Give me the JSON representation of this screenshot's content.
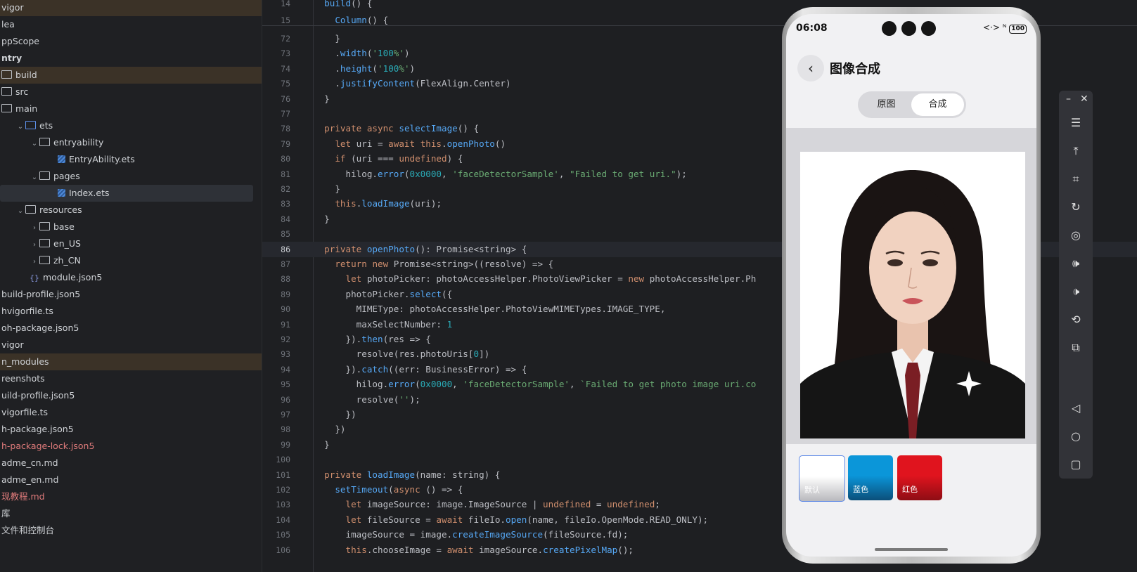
{
  "tree": {
    "rows": [
      {
        "label": "vigor",
        "indent": 0,
        "hl": "brown"
      },
      {
        "label": "lea",
        "indent": 0
      },
      {
        "label": "ppScope",
        "indent": 0
      },
      {
        "label": "ntry",
        "indent": 0,
        "bold": true
      },
      {
        "label": "build",
        "indent": 0,
        "hl": "brown",
        "prefix": "folder"
      },
      {
        "label": "src",
        "indent": 0,
        "prefix": "folder"
      },
      {
        "label": "main",
        "indent": 0,
        "prefix": "folder"
      },
      {
        "label": "ets",
        "indent": 1,
        "chev": "v",
        "prefix": "folder-blue"
      },
      {
        "label": "entryability",
        "indent": 2,
        "chev": "v",
        "prefix": "folder"
      },
      {
        "label": "EntryAbility.ets",
        "indent": 4,
        "prefix": "file"
      },
      {
        "label": "pages",
        "indent": 2,
        "chev": "v",
        "prefix": "folder"
      },
      {
        "label": "Index.ets",
        "indent": 4,
        "prefix": "file",
        "hl": "sel"
      },
      {
        "label": "resources",
        "indent": 1,
        "chev": "v",
        "prefix": "folder"
      },
      {
        "label": "base",
        "indent": 2,
        "chev": ">",
        "prefix": "folder"
      },
      {
        "label": "en_US",
        "indent": 2,
        "chev": ">",
        "prefix": "folder"
      },
      {
        "label": "zh_CN",
        "indent": 2,
        "chev": ">",
        "prefix": "folder"
      },
      {
        "label": "module.json5",
        "indent": 2,
        "prefix": "json"
      },
      {
        "label": "build-profile.json5",
        "indent": 0
      },
      {
        "label": "hvigorfile.ts",
        "indent": 0
      },
      {
        "label": "oh-package.json5",
        "indent": 0
      },
      {
        "label": "vigor",
        "indent": 0
      },
      {
        "label": "n_modules",
        "indent": 0,
        "hl": "brown"
      },
      {
        "label": "reenshots",
        "indent": 0
      },
      {
        "label": "uild-profile.json5",
        "indent": 0
      },
      {
        "label": "vigorfile.ts",
        "indent": 0
      },
      {
        "label": "h-package.json5",
        "indent": 0
      },
      {
        "label": "h-package-lock.json5",
        "indent": 0,
        "red": true
      },
      {
        "label": "adme_cn.md",
        "indent": 0
      },
      {
        "label": "adme_en.md",
        "indent": 0
      },
      {
        "label": "现教程.md",
        "indent": 0,
        "red": true
      },
      {
        "label": "库",
        "indent": 0
      },
      {
        "label": "文件和控制台",
        "indent": 0
      }
    ]
  },
  "editor": {
    "current_line": "86",
    "lines": [
      {
        "n": "14",
        "t": "  build() {"
      },
      {
        "n": "15",
        "t": "    Column() {"
      },
      {
        "n": "72",
        "t": "    }"
      },
      {
        "n": "73",
        "t": "    .width('100%')"
      },
      {
        "n": "74",
        "t": "    .height('100%')"
      },
      {
        "n": "75",
        "t": "    .justifyContent(FlexAlign.Center)"
      },
      {
        "n": "76",
        "t": "  }"
      },
      {
        "n": "77",
        "t": ""
      },
      {
        "n": "78",
        "t": "  private async selectImage() {"
      },
      {
        "n": "79",
        "t": "    let uri = await this.openPhoto()"
      },
      {
        "n": "80",
        "t": "    if (uri === undefined) {"
      },
      {
        "n": "81",
        "t": "      hilog.error(0x0000, 'faceDetectorSample', \"Failed to get uri.\");"
      },
      {
        "n": "82",
        "t": "    }"
      },
      {
        "n": "83",
        "t": "    this.loadImage(uri);"
      },
      {
        "n": "84",
        "t": "  }"
      },
      {
        "n": "85",
        "t": ""
      },
      {
        "n": "86",
        "t": "  private openPhoto(): Promise<string> {"
      },
      {
        "n": "87",
        "t": "    return new Promise<string>((resolve) => {"
      },
      {
        "n": "88",
        "t": "      let photoPicker: photoAccessHelper.PhotoViewPicker = new photoAccessHelper.Ph"
      },
      {
        "n": "89",
        "t": "      photoPicker.select({"
      },
      {
        "n": "90",
        "t": "        MIMEType: photoAccessHelper.PhotoViewMIMETypes.IMAGE_TYPE,"
      },
      {
        "n": "91",
        "t": "        maxSelectNumber: 1"
      },
      {
        "n": "92",
        "t": "      }).then(res => {"
      },
      {
        "n": "93",
        "t": "        resolve(res.photoUris[0])"
      },
      {
        "n": "94",
        "t": "      }).catch((err: BusinessError) => {"
      },
      {
        "n": "95",
        "t": "        hilog.error(0x0000, 'faceDetectorSample', `Failed to get photo image uri.co"
      },
      {
        "n": "96",
        "t": "        resolve('');"
      },
      {
        "n": "97",
        "t": "      })"
      },
      {
        "n": "98",
        "t": "    })"
      },
      {
        "n": "99",
        "t": "  }"
      },
      {
        "n": "100",
        "t": ""
      },
      {
        "n": "101",
        "t": "  private loadImage(name: string) {"
      },
      {
        "n": "102",
        "t": "    setTimeout(async () => {"
      },
      {
        "n": "103",
        "t": "      let imageSource: image.ImageSource | undefined = undefined;"
      },
      {
        "n": "104",
        "t": "      let fileSource = await fileIo.open(name, fileIo.OpenMode.READ_ONLY);"
      },
      {
        "n": "105",
        "t": "      imageSource = image.createImageSource(fileSource.fd);"
      },
      {
        "n": "106",
        "t": "      this.chooseImage = await imageSource.createPixelMap();"
      }
    ]
  },
  "phone": {
    "time": "06:08",
    "battery": "100",
    "signal_text": "<·> ᴺᵀ",
    "title": "图像合成",
    "back_icon": "chevron-left-icon",
    "segments": [
      "原图",
      "合成"
    ],
    "active_segment": "合成",
    "swatches": [
      {
        "label": "默认",
        "color": "#ffffff",
        "selected": true
      },
      {
        "label": "蓝色",
        "color": "#0b96d9"
      },
      {
        "label": "红色",
        "color": "#e0141e"
      }
    ]
  },
  "toolbar": {
    "icons": [
      "minimize-icon",
      "close-icon",
      "menu-icon",
      "pin-top-icon",
      "crop-icon",
      "rotate-icon",
      "screenshot-icon",
      "volume-up-icon",
      "volume-down-icon",
      "shake-icon",
      "multi-window-icon",
      "back-icon",
      "home-icon",
      "recents-icon"
    ]
  }
}
